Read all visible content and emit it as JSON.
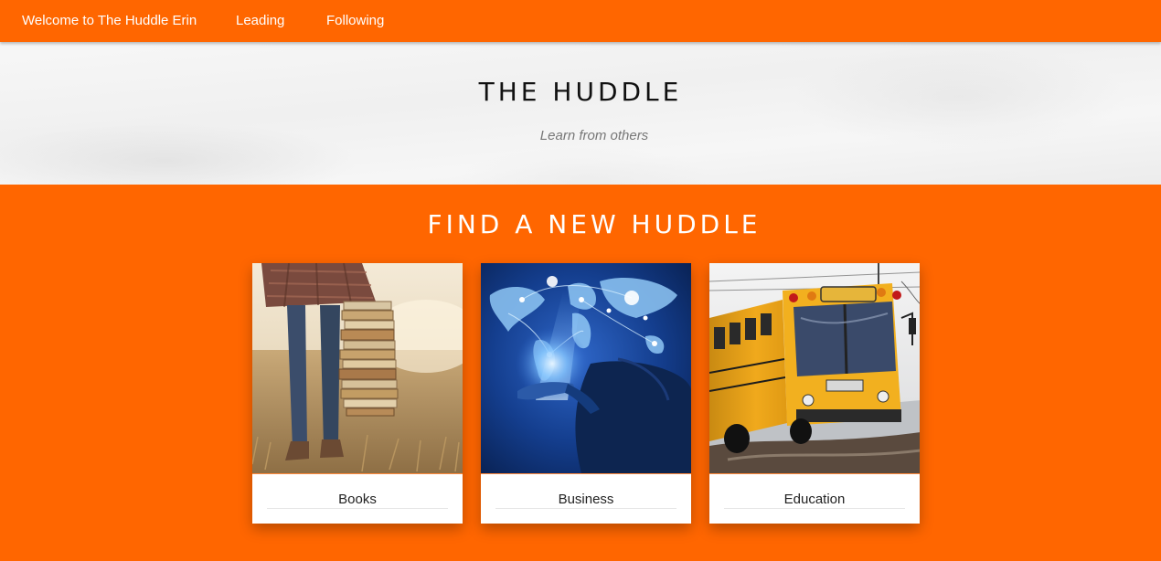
{
  "nav": {
    "welcome": "Welcome to The Huddle Erin",
    "leading": "Leading",
    "following": "Following"
  },
  "hero": {
    "title": "THE HUDDLE",
    "subtitle": "Learn from others"
  },
  "find": {
    "title": "FIND A NEW HUDDLE",
    "cards": [
      {
        "label": "Books",
        "image": "books-photo"
      },
      {
        "label": "Business",
        "image": "business-photo"
      },
      {
        "label": "Education",
        "image": "education-photo"
      }
    ]
  },
  "colors": {
    "brand_orange": "#ff6600",
    "hero_bg": "#f3f3f3",
    "card_bg": "#ffffff"
  }
}
